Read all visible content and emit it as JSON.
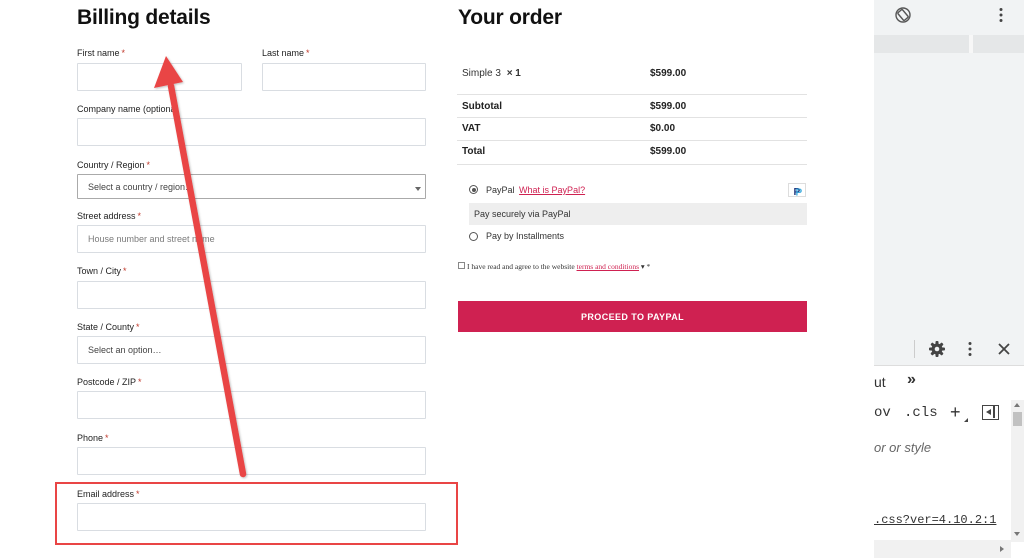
{
  "billing": {
    "title": "Billing details",
    "required_mark": "*",
    "first_name_label": "First name",
    "last_name_label": "Last name",
    "company_label": "Company name (optiona",
    "country_label": "Country / Region",
    "country_value": "Select a country / region…",
    "street_label": "Street address",
    "street_placeholder": "House number and street name",
    "city_label": "Town / City",
    "state_label": "State / County",
    "state_value": "Select an option…",
    "postcode_label": "Postcode / ZIP",
    "phone_label": "Phone",
    "email_label": "Email address"
  },
  "order": {
    "title": "Your order",
    "item_name": "Simple 3",
    "item_qty": "× 1",
    "item_price": "$599.00",
    "subtotal_label": "Subtotal",
    "subtotal_value": "$599.00",
    "vat_label": "VAT",
    "vat_value": "$0.00",
    "total_label": "Total",
    "total_value": "$599.00",
    "paypal_label": "PayPal",
    "paypal_link": "What is PayPal?",
    "paypal_desc": "Pay securely via PayPal",
    "installments_label": "Pay by Installments",
    "terms_prefix": "I have read and agree to the website",
    "terms_link": "terms and conditions",
    "terms_suffix": "▾ *",
    "proceed_button": "PROCEED TO PAYPAL"
  },
  "devtools": {
    "tab_partial": "ut",
    "more_tabs": "»",
    "styles_partial": "ov",
    "cls_label": ".cls",
    "add_label": "+",
    "filter_hint": "or or style",
    "source_link": ".css?ver=4.10.2:1"
  },
  "icons": {
    "rotate": "rotate-icon",
    "kebab": "kebab-icon",
    "gear": "gear-icon",
    "close": "close-icon",
    "sidebar_toggle": "sidebar-toggle-icon"
  },
  "colors": {
    "accent": "#cf2151",
    "annotation": "#e94545"
  }
}
